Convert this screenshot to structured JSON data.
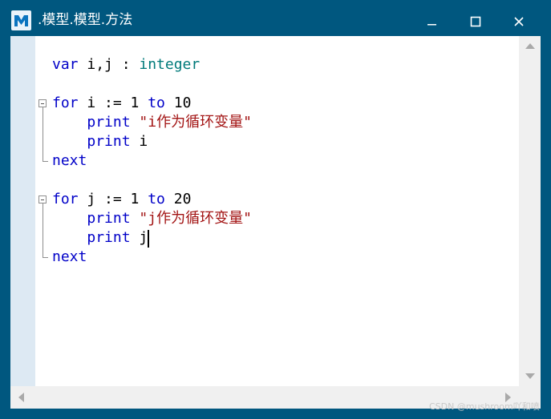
{
  "window": {
    "title": ".模型.模型.方法",
    "accent_color": "#00577f",
    "icons": {
      "app": "m-logo-icon",
      "minimize": "minimize-icon",
      "maximize": "maximize-icon",
      "close": "close-icon"
    }
  },
  "editor": {
    "lines": {
      "l1": {
        "kw": "var",
        "a": " i,j : ",
        "ty": "integer"
      },
      "l3": {
        "kw1": "for",
        "a": " i := 1 ",
        "kw2": "to",
        "b": " 10"
      },
      "l4": {
        "indent": "    ",
        "kw": "print",
        "sp": " ",
        "str": "\"i作为循环变量\""
      },
      "l5": {
        "indent": "    ",
        "kw": "print",
        "b": " i"
      },
      "l6": {
        "kw": "next"
      },
      "l8": {
        "kw1": "for",
        "a": " j := 1 ",
        "kw2": "to",
        "b": " 20"
      },
      "l9": {
        "indent": "    ",
        "kw": "print",
        "sp": " ",
        "str": "\"j作为循环变量\""
      },
      "l10": {
        "indent": "    ",
        "kw": "print",
        "b": " j"
      },
      "l11": {
        "kw": "next"
      }
    }
  },
  "watermark": "CSDN @mushroom吖和喷"
}
